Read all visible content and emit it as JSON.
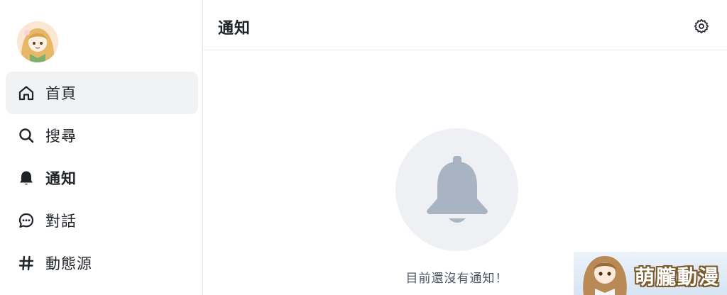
{
  "sidebar": {
    "avatar_icon": "user-avatar-anime-girl",
    "items": [
      {
        "label": "首頁",
        "icon": "home-icon",
        "active": true
      },
      {
        "label": "搜尋",
        "icon": "search-icon",
        "active": false
      },
      {
        "label": "通知",
        "icon": "bell-icon",
        "active": false,
        "bold": true
      },
      {
        "label": "對話",
        "icon": "chat-icon",
        "active": false
      },
      {
        "label": "動態源",
        "icon": "hashtag-icon",
        "active": false
      }
    ]
  },
  "header": {
    "title": "通知",
    "settings_icon": "gear-icon"
  },
  "main": {
    "empty_icon": "bell-icon",
    "empty_text": "目前還沒有通知！"
  },
  "watermark": {
    "text": "萌朧動漫"
  },
  "colors": {
    "active_bg": "#f1f2f4",
    "border": "#e5e7eb",
    "bell_fill": "#a9b4c2",
    "bell_circle": "#eef0f3",
    "text": "#1f2328",
    "muted_text": "#4b5563"
  }
}
